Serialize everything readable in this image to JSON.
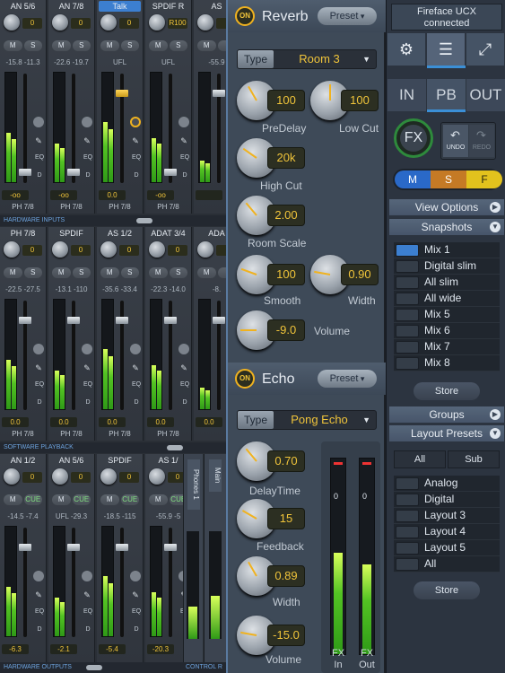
{
  "rows": [
    {
      "label": "HARDWARE INPUTS",
      "channels": [
        {
          "name": "AN 5/6",
          "knob": "0",
          "gain": "-15.8 -11.3",
          "fader": "-oo",
          "route": "PH 7/8",
          "m": "M",
          "s": "S",
          "sel": false
        },
        {
          "name": "AN 7/8",
          "knob": "0",
          "gain": "-22.6 -19.7",
          "fader": "-oo",
          "route": "PH 7/8",
          "m": "M",
          "s": "S",
          "sel": false
        },
        {
          "name": "Talk",
          "knob": "0",
          "gain": "UFL",
          "fader": "0.0",
          "route": "PH 7/8",
          "m": "M",
          "s": "S",
          "sel": true
        },
        {
          "name": "SPDIF R",
          "knob": "R100",
          "gain": "UFL",
          "fader": "-oo",
          "route": "PH 7/8",
          "m": "M",
          "s": "S",
          "sel": false
        },
        {
          "name": "AS",
          "knob": "",
          "gain": "-55.9",
          "fader": "",
          "route": "",
          "m": "M",
          "s": "",
          "sel": false
        }
      ]
    },
    {
      "label": "SOFTWARE PLAYBACK",
      "channels": [
        {
          "name": "PH 7/8",
          "knob": "0",
          "gain": "-22.5 -27.5",
          "fader": "0.0",
          "route": "PH 7/8",
          "m": "M",
          "s": "S",
          "sel": false
        },
        {
          "name": "SPDIF",
          "knob": "0",
          "gain": "-13.1 -110",
          "fader": "0.0",
          "route": "PH 7/8",
          "m": "M",
          "s": "S",
          "sel": false
        },
        {
          "name": "AS 1/2",
          "knob": "0",
          "gain": "-35.6 -33.4",
          "fader": "0.0",
          "route": "PH 7/8",
          "m": "M",
          "s": "S",
          "sel": false
        },
        {
          "name": "ADAT 3/4",
          "knob": "0",
          "gain": "-22.3 -14.0",
          "fader": "0.0",
          "route": "PH 7/8",
          "m": "M",
          "s": "S",
          "sel": false
        },
        {
          "name": "ADA",
          "knob": "",
          "gain": "-8.",
          "fader": "0.0",
          "route": "",
          "m": "M",
          "s": "",
          "sel": false
        }
      ]
    },
    {
      "label": "HARDWARE OUTPUTS",
      "channels": [
        {
          "name": "AN 1/2",
          "knob": "0",
          "gain": "-14.5 -7.4",
          "fader": "-6.3",
          "route": "",
          "m": "M",
          "s": "CUE",
          "sel": false
        },
        {
          "name": "AN 5/6",
          "knob": "0",
          "gain": "UFL -29.3",
          "fader": "-2.1",
          "route": "",
          "m": "M",
          "s": "CUE",
          "sel": false
        },
        {
          "name": "SPDIF",
          "knob": "0",
          "gain": "-18.5 -115",
          "fader": "-5.4",
          "route": "",
          "m": "M",
          "s": "CUE",
          "sel": false
        },
        {
          "name": "AS 1/",
          "knob": "0",
          "gain": "-55.9 -5",
          "fader": "-20.3",
          "route": "",
          "m": "M",
          "s": "CUE",
          "sel": false
        }
      ]
    }
  ],
  "side": {
    "eq": "EQ",
    "d": "D",
    "t": "T"
  },
  "out_tabs": {
    "phones": "Phones 1",
    "main": "Main",
    "control": "CONTROL R"
  },
  "reverb": {
    "on": "ON",
    "title": "Reverb",
    "preset": "Preset",
    "type_label": "Type",
    "type": "Room 3",
    "params": [
      {
        "label": "PreDelay",
        "value": "100"
      },
      {
        "label": "Low Cut",
        "value": "100"
      },
      {
        "label": "High Cut",
        "value": "20k"
      },
      {
        "label": "Room Scale",
        "value": "2.00"
      },
      {
        "label": "Smooth",
        "value": "100"
      },
      {
        "label": "Width",
        "value": "0.90"
      },
      {
        "label": "Volume",
        "value": "-9.0"
      }
    ]
  },
  "echo": {
    "on": "ON",
    "title": "Echo",
    "preset": "Preset",
    "type_label": "Type",
    "type": "Pong Echo",
    "params": [
      {
        "label": "DelayTime",
        "value": "0.70"
      },
      {
        "label": "Feedback",
        "value": "15"
      },
      {
        "label": "Width",
        "value": "0.89"
      },
      {
        "label": "Volume",
        "value": "-15.0"
      }
    ],
    "meter_in": "FX In",
    "meter_out": "FX Out",
    "meter_zero": "0"
  },
  "device": {
    "line1": "Fireface UCX",
    "line2": "connected"
  },
  "modes": [
    "IN",
    "PB",
    "OUT"
  ],
  "fx_button": "FX",
  "undo": "UNDO",
  "redo": "REDO",
  "msf": [
    "M",
    "S",
    "F"
  ],
  "sections": {
    "view_options": "View Options",
    "snapshots": "Snapshots",
    "groups": "Groups",
    "layout_presets": "Layout Presets"
  },
  "snapshots": [
    "Mix 1",
    "Digital slim",
    "All slim",
    "All wide",
    "Mix 5",
    "Mix 6",
    "Mix 7",
    "Mix 8"
  ],
  "store": "Store",
  "layout_tabs": [
    "All",
    "Sub"
  ],
  "layouts": [
    "Analog",
    "Digital",
    "Layout 3",
    "Layout 4",
    "Layout 5",
    "All"
  ],
  "colors": {
    "accent": "#f0b21f",
    "select": "#3c7fd0",
    "meter": "#53c323"
  }
}
